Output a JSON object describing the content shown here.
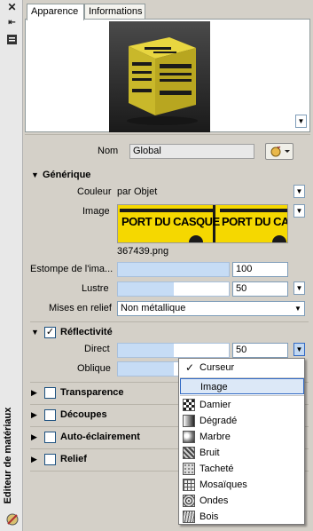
{
  "palette": {
    "title": "Editeur de matériaux"
  },
  "tabs": [
    {
      "label": "Apparence"
    },
    {
      "label": "Informations"
    }
  ],
  "preview": {
    "cube_text": "PORT DU CASQUE OBLIGATOIRE"
  },
  "name_row": {
    "label": "Nom",
    "value": "Global"
  },
  "generic": {
    "title": "Générique",
    "color_label": "Couleur",
    "color_value": "par Objet",
    "image_label": "Image",
    "image_text": "PORT DU CASQUE",
    "image_filename": "367439.png",
    "fade_label": "Estompe de l'ima...",
    "fade_value": "100",
    "fade_fraction": 1.0,
    "gloss_label": "Lustre",
    "gloss_value": "50",
    "gloss_fraction": 0.5,
    "highlights_label": "Mises en relief",
    "highlights_value": "Non métallique"
  },
  "reflectivity": {
    "title": "Réflectivité",
    "direct_label": "Direct",
    "direct_value": "50",
    "direct_fraction": 0.5,
    "oblique_label": "Oblique",
    "oblique_fraction": 0.5
  },
  "sections": [
    {
      "title": "Transparence"
    },
    {
      "title": "Découpes"
    },
    {
      "title": "Auto-éclairement"
    },
    {
      "title": "Relief"
    }
  ],
  "menu": {
    "items": [
      {
        "label": "Curseur",
        "checked": true
      },
      {
        "label": "Image",
        "selected": true
      },
      {
        "label": "Damier",
        "icon": "checker-icon"
      },
      {
        "label": "Dégradé",
        "icon": "gradient-icon"
      },
      {
        "label": "Marbre",
        "icon": "marble-icon"
      },
      {
        "label": "Bruit",
        "icon": "noise-icon"
      },
      {
        "label": "Tacheté",
        "icon": "speckle-icon"
      },
      {
        "label": "Mosaïques",
        "icon": "tiles-icon"
      },
      {
        "label": "Ondes",
        "icon": "waves-icon"
      },
      {
        "label": "Bois",
        "icon": "wood-icon"
      }
    ]
  },
  "colors": {
    "accent": "#316ac5",
    "sign_yellow": "#f5d800",
    "slider_fill": "#c6dcf5"
  }
}
